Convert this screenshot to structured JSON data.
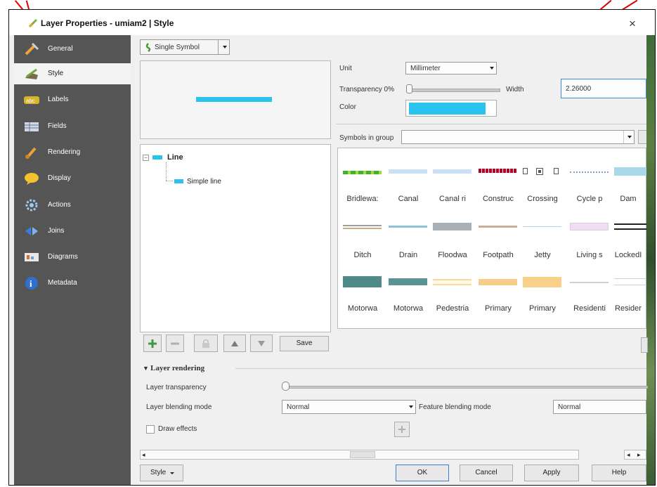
{
  "window": {
    "title": "Layer Properties - umiam2 | Style",
    "close": "×"
  },
  "sidebar": {
    "items": [
      {
        "label": "General",
        "icon": "wrench-icon"
      },
      {
        "label": "Style",
        "icon": "paint-brush-icon"
      },
      {
        "label": "Labels",
        "icon": "abc-label-icon"
      },
      {
        "label": "Fields",
        "icon": "table-icon"
      },
      {
        "label": "Rendering",
        "icon": "paintbrush-icon"
      },
      {
        "label": "Display",
        "icon": "speech-bubble-icon"
      },
      {
        "label": "Actions",
        "icon": "gear-icon"
      },
      {
        "label": "Joins",
        "icon": "join-arrows-icon"
      },
      {
        "label": "Diagrams",
        "icon": "diagram-icon"
      },
      {
        "label": "Metadata",
        "icon": "info-icon"
      }
    ]
  },
  "renderer": {
    "type": "Single Symbol"
  },
  "symbol_tree": {
    "root": "Line",
    "child": "Simple line"
  },
  "props": {
    "unit_label": "Unit",
    "unit_value": "Millimeter",
    "transparency_label": "Transparency 0%",
    "width_label": "Width",
    "width_value": "2.26000",
    "color_label": "Color",
    "color_value": "#29c3ee"
  },
  "symbols_group": {
    "label": "Symbols in group",
    "value": ""
  },
  "library": [
    {
      "name": "Bridleway",
      "shown": "Bridlewa:"
    },
    {
      "name": "Canal",
      "shown": "Canal"
    },
    {
      "name": "Canal ri",
      "shown": "Canal ri"
    },
    {
      "name": "Construc",
      "shown": "Construc"
    },
    {
      "name": "Crossing",
      "shown": "Crossing"
    },
    {
      "name": "Cycle p",
      "shown": "Cycle p"
    },
    {
      "name": "Dam",
      "shown": "Dam"
    },
    {
      "name": "Ditch",
      "shown": "Ditch"
    },
    {
      "name": "Drain",
      "shown": "Drain"
    },
    {
      "name": "Floodway",
      "shown": "Floodwa"
    },
    {
      "name": "Footpath",
      "shown": "Footpath"
    },
    {
      "name": "Jetty",
      "shown": "Jetty"
    },
    {
      "name": "Living s",
      "shown": "Living s"
    },
    {
      "name": "LockedI",
      "shown": "LockedI"
    },
    {
      "name": "Motorway",
      "shown": "Motorwa"
    },
    {
      "name": "Motorway",
      "shown": "Motorwa"
    },
    {
      "name": "Pedestrian",
      "shown": "Pedestria"
    },
    {
      "name": "Primary",
      "shown": "Primary"
    },
    {
      "name": "Primary",
      "shown": "Primary"
    },
    {
      "name": "Residential",
      "shown": "Residenti"
    },
    {
      "name": "Residen",
      "shown": "Resider"
    }
  ],
  "tree_buttons": {
    "save": "Save"
  },
  "layer_rendering": {
    "heading": "Layer rendering",
    "transparency_label": "Layer transparency",
    "blending_label": "Layer blending mode",
    "blending_value": "Normal",
    "feature_blending_label": "Feature blending mode",
    "feature_blending_value": "Normal",
    "draw_effects_label": "Draw effects"
  },
  "footer": {
    "style": "Style",
    "ok": "OK",
    "cancel": "Cancel",
    "apply": "Apply",
    "help": "Help"
  }
}
